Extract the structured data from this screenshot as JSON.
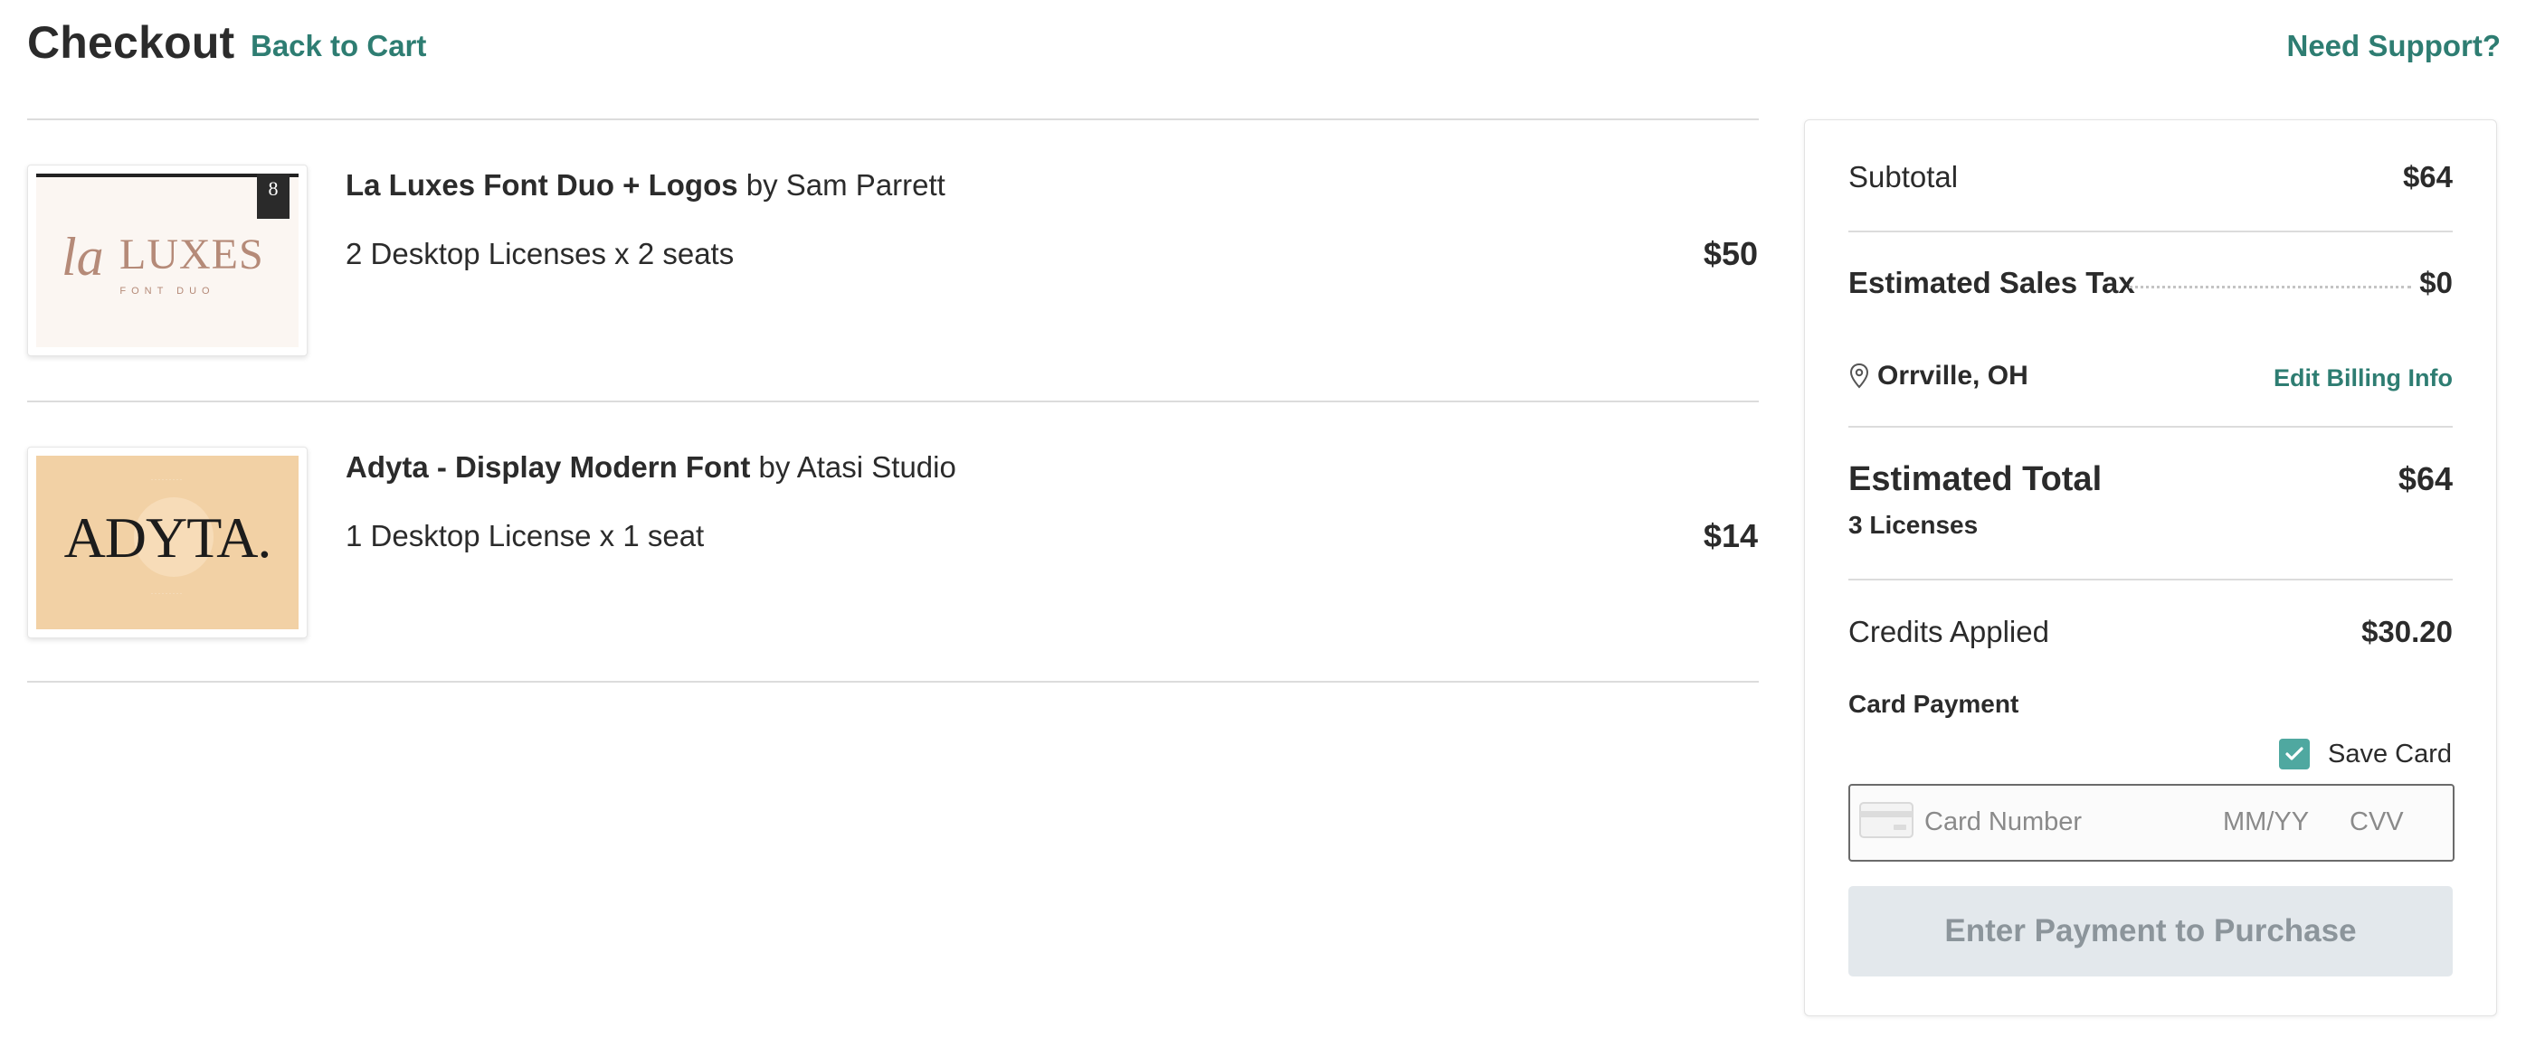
{
  "header": {
    "title": "Checkout",
    "back_link": "Back to Cart",
    "support_link": "Need Support?"
  },
  "items": [
    {
      "name": "La Luxes Font Duo + Logos",
      "by": "by Sam Parrett",
      "license": "2 Desktop Licenses x 2 seats",
      "price": "$50",
      "thumb": {
        "logo_script": "la",
        "logo_caps": "LUXES",
        "logo_sub": "FONT DUO",
        "badge": "8",
        "bg": "#fbf6f2",
        "accent": "#b58a78"
      }
    },
    {
      "name": "Adyta - Display Modern Font",
      "by": "by Atasi Studio",
      "license": "1 Desktop License x 1 seat",
      "price": "$14",
      "thumb": {
        "logo": "ADYTA.",
        "bg": "#f2d1a5"
      }
    }
  ],
  "summary": {
    "subtotal_label": "Subtotal",
    "subtotal_value": "$64",
    "tax_label": "Estimated Sales Tax",
    "tax_value": "$0",
    "location": "Orrville, OH",
    "location_icon": "map-pin-icon",
    "edit_billing": "Edit Billing Info",
    "total_label": "Estimated Total",
    "total_value": "$64",
    "licenses": "3 Licenses",
    "credits_label": "Credits Applied",
    "credits_value": "$30.20",
    "card_payment_label": "Card Payment",
    "save_card_label": "Save Card",
    "save_card_checked": true,
    "card_number_placeholder": "Card Number",
    "expiry_placeholder": "MM/YY",
    "cvv_placeholder": "CVV",
    "purchase_button": "Enter Payment to Purchase"
  },
  "colors": {
    "accent_teal": "#2e7d72",
    "checkbox_teal": "#4fa8a0",
    "button_disabled_bg": "#e3e8ec",
    "button_disabled_text": "#8c959b"
  }
}
